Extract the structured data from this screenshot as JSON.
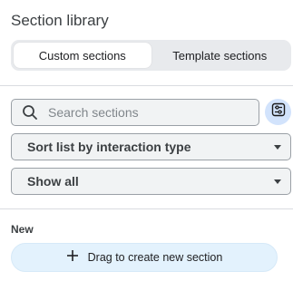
{
  "panel": {
    "title": "Section library"
  },
  "tabs": {
    "custom_label": "Custom sections",
    "template_label": "Template sections",
    "active": "custom"
  },
  "search": {
    "placeholder": "Search sections",
    "value": "",
    "icon": "search-icon",
    "filter_icon": "filter-settings-icon"
  },
  "sort_select": {
    "label": "Sort list by interaction type"
  },
  "show_select": {
    "label": "Show all"
  },
  "new_section": {
    "heading": "New",
    "button_label": "Drag to create new section",
    "icon": "plus-icon"
  },
  "colors": {
    "accent_light": "#e3f2fd",
    "filter_bg": "#d2e3fc",
    "segmented_bg": "#e8eaed",
    "field_bg": "#f1f3f4"
  }
}
